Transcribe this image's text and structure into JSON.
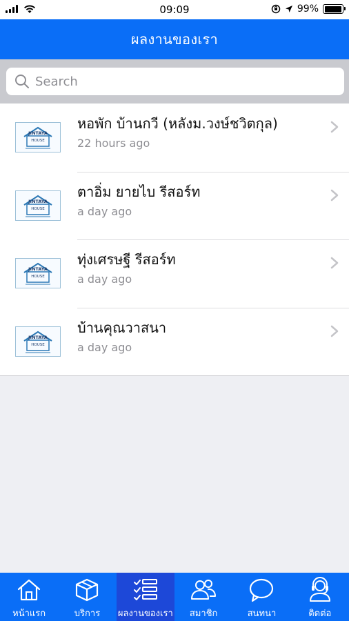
{
  "status_bar": {
    "time": "09:09",
    "battery": "99%",
    "battery_level": 0.99
  },
  "nav": {
    "title": "ผลงานของเรา"
  },
  "search": {
    "placeholder": "Search",
    "value": ""
  },
  "list": [
    {
      "title": "หอพัก บ้านกวี (หลังม.วงษ์ชวิตกุล)",
      "time": "22 hours ago",
      "thumb_icon": "jintaya-house-logo"
    },
    {
      "title": "ตาอิ่ม ยายไบ รีสอร์ท",
      "time": "a day ago",
      "thumb_icon": "jintaya-house-logo"
    },
    {
      "title": "ทุ่งเศรษฐี รีสอร์ท",
      "time": "a day ago",
      "thumb_icon": "jintaya-house-logo"
    },
    {
      "title": "บ้านคุณวาสนา",
      "time": "a day ago",
      "thumb_icon": "jintaya-house-logo"
    }
  ],
  "thumb_logo_text": "JINTAYA HOUSE",
  "tabs": [
    {
      "label": "หน้าแรก",
      "icon": "home-icon",
      "active": false
    },
    {
      "label": "บริการ",
      "icon": "box-icon",
      "active": false
    },
    {
      "label": "ผลงานของเรา",
      "icon": "checklist-icon",
      "active": true
    },
    {
      "label": "สมาชิก",
      "icon": "members-icon",
      "active": false
    },
    {
      "label": "สนทนา",
      "icon": "chat-icon",
      "active": false
    },
    {
      "label": "ติดต่อ",
      "icon": "contact-support-icon",
      "active": false
    }
  ],
  "colors": {
    "brand_blue": "#0a6ef7",
    "active_tab": "#1d48d8"
  }
}
